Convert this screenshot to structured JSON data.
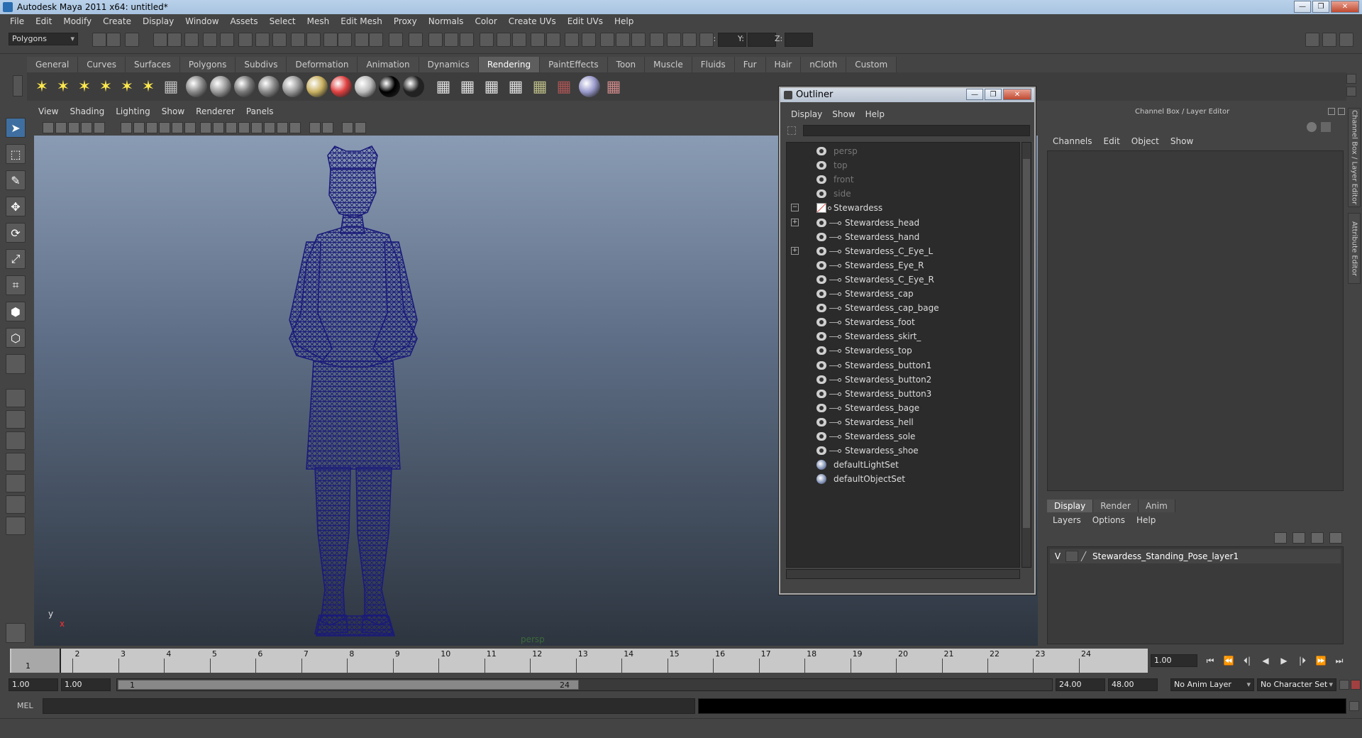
{
  "window": {
    "title": "Autodesk Maya 2011 x64: untitled*",
    "buttons": [
      "—",
      "❐",
      "✕"
    ]
  },
  "menus": [
    "File",
    "Edit",
    "Modify",
    "Create",
    "Display",
    "Window",
    "Assets",
    "Select",
    "Mesh",
    "Edit Mesh",
    "Proxy",
    "Normals",
    "Color",
    "Create UVs",
    "Edit UVs",
    "Help"
  ],
  "statusline": {
    "mode": "Polygons",
    "x_label": "X:",
    "y_label": "Y:",
    "z_label": "Z:"
  },
  "shelf": {
    "tabs": [
      "General",
      "Curves",
      "Surfaces",
      "Polygons",
      "Subdivs",
      "Deformation",
      "Animation",
      "Dynamics",
      "Rendering",
      "PaintEffects",
      "Toon",
      "Muscle",
      "Fluids",
      "Fur",
      "Hair",
      "nCloth",
      "Custom"
    ],
    "active_tab": "Rendering"
  },
  "viewport": {
    "menus": [
      "View",
      "Shading",
      "Lighting",
      "Show",
      "Renderer",
      "Panels"
    ],
    "camera_label": "persp",
    "axis_y": "y",
    "axis_x": "x",
    "mesh_color": "#1a1a7a"
  },
  "outliner": {
    "title": "Outliner",
    "buttons": [
      "—",
      "❐",
      "✕"
    ],
    "menus": [
      "Display",
      "Show",
      "Help"
    ],
    "cameras": [
      "persp",
      "top",
      "front",
      "side"
    ],
    "group": "Stewardess",
    "group_expander": "−",
    "children": [
      "Stewardess_head",
      "Stewardess_hand",
      "Stewardess_C_Eye_L",
      "Stewardess_Eye_R",
      "Stewardess_C_Eye_R",
      "Stewardess_cap",
      "Stewardess_cap_bage",
      "Stewardess_foot",
      "Stewardess_skirt_",
      "Stewardess_top",
      "Stewardess_button1",
      "Stewardess_button2",
      "Stewardess_button3",
      "Stewardess_bage",
      "Stewardess_hell",
      "Stewardess_sole",
      "Stewardess_shoe"
    ],
    "expandable_children": [
      "Stewardess_head",
      "Stewardess_C_Eye_L"
    ],
    "child_expander": "+",
    "sets": [
      "defaultLightSet",
      "defaultObjectSet"
    ]
  },
  "channel_box": {
    "title": "Channel Box / Layer Editor",
    "menus": [
      "Channels",
      "Edit",
      "Object",
      "Show"
    ],
    "side_tabs": [
      "Channel Box / Layer Editor",
      "Attribute Editor"
    ]
  },
  "layer_editor": {
    "tabs": [
      "Display",
      "Render",
      "Anim"
    ],
    "active_tab": "Display",
    "menus": [
      "Layers",
      "Options",
      "Help"
    ],
    "layers": [
      {
        "visible": "V",
        "name": "Stewardess_Standing_Pose_layer1"
      }
    ]
  },
  "timeline": {
    "start": 1,
    "end": 24,
    "current_frame": 1,
    "current_frame_label": "1",
    "current_frame_field": "1.00",
    "playback_buttons": [
      "⏮",
      "⏪",
      "⏴|",
      "◀",
      "▶",
      "|⏵",
      "⏩",
      "⏭"
    ]
  },
  "range": {
    "start_time": "1.00",
    "playback_start": "1.00",
    "bar_start": "1",
    "bar_end": "24",
    "playback_end": "24.00",
    "end_time": "48.00",
    "anim_layer": "No Anim Layer",
    "character_set": "No Character Set"
  },
  "command_line": {
    "label": "MEL"
  }
}
